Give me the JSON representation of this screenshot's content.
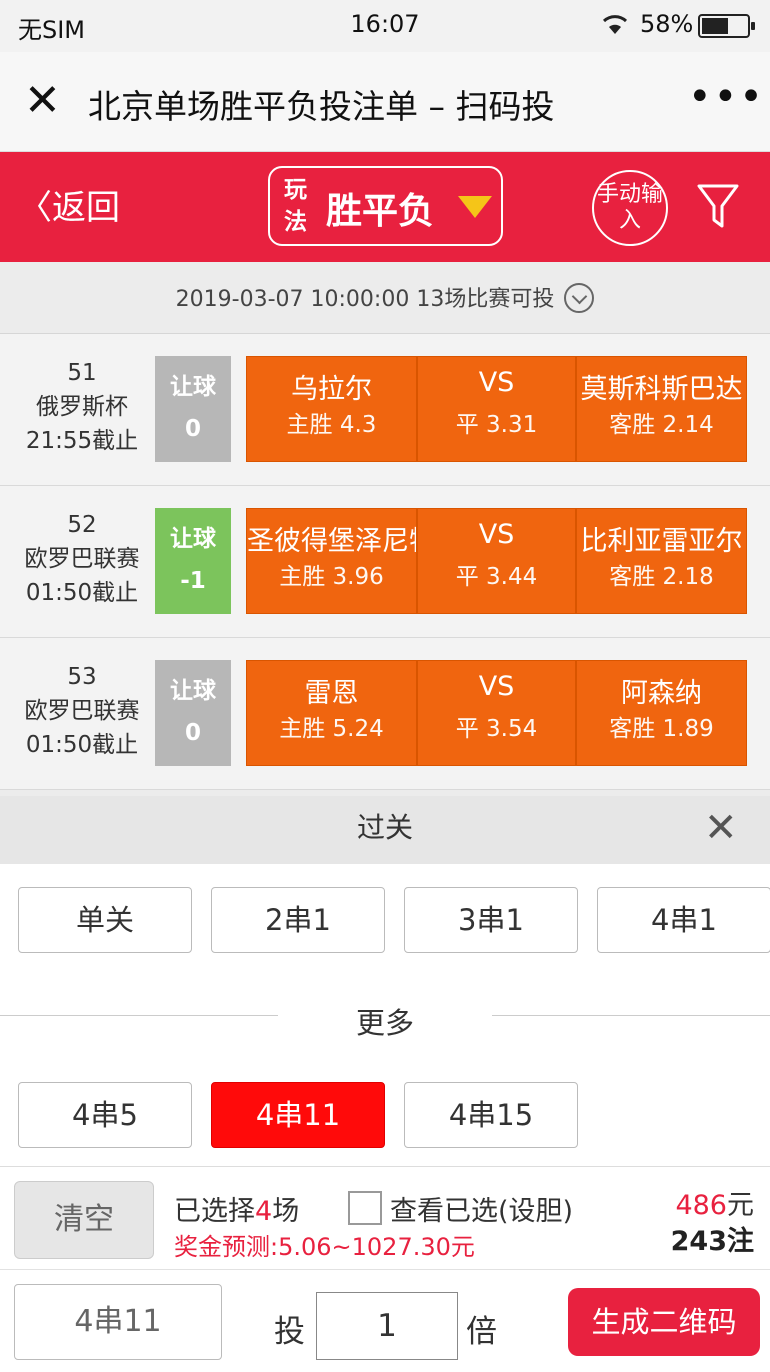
{
  "status_bar": {
    "carrier": "无SIM",
    "time": "16:07",
    "battery": "58%"
  },
  "nav": {
    "title": "北京单场胜平负投注单 – 扫码投",
    "more": "•••"
  },
  "toolbar": {
    "back_label": "返回",
    "play_tag": "玩法",
    "play_name": "胜平负",
    "manual_label": "手动输入",
    "accent_color": "#e8213f"
  },
  "info": {
    "text": "2019-03-07 10:00:00 13场比赛可投"
  },
  "matches": [
    {
      "no": "51",
      "league": "俄罗斯杯",
      "deadline": "21:55截止",
      "handicap_label": "让球",
      "handicap_value": "0",
      "home": "乌拉尔",
      "home_odds": "主胜 4.3",
      "vs": "VS",
      "draw_odds": "平 3.31",
      "away": "莫斯科斯巴达",
      "away_odds": "客胜 2.14"
    },
    {
      "no": "52",
      "league": "欧罗巴联赛",
      "deadline": "01:50截止",
      "handicap_label": "让球",
      "handicap_value": "-1",
      "home": "圣彼得堡泽尼特",
      "home_odds": "主胜 3.96",
      "vs": "VS",
      "draw_odds": "平 3.44",
      "away": "比利亚雷亚尔",
      "away_odds": "客胜 2.18"
    },
    {
      "no": "53",
      "league": "欧罗巴联赛",
      "deadline": "01:50截止",
      "handicap_label": "让球",
      "handicap_value": "0",
      "home": "雷恩",
      "home_odds": "主胜 5.24",
      "vs": "VS",
      "draw_odds": "平 3.54",
      "away": "阿森纳",
      "away_odds": "客胜 1.89"
    }
  ],
  "guoguan": {
    "title": "过关",
    "basic_options": [
      "单关",
      "2串1",
      "3串1",
      "4串1"
    ],
    "more_label": "更多",
    "more_options": [
      "4串5",
      "4串11",
      "4串15"
    ],
    "selected": "4串11"
  },
  "summary": {
    "clear_label": "清空",
    "selected_prefix": "已选择",
    "selected_count": "4",
    "selected_suffix": "场",
    "view_label": "查看已选(设胆)",
    "prize_label": "奖金预测:5.06~1027.30元",
    "amount": "486",
    "amount_unit": "元",
    "bets": "243注"
  },
  "bottom": {
    "chuan_label": "4串11",
    "tou_label": "投",
    "multiplier": "1",
    "bei_label": "倍",
    "generate_label": "生成二维码"
  }
}
